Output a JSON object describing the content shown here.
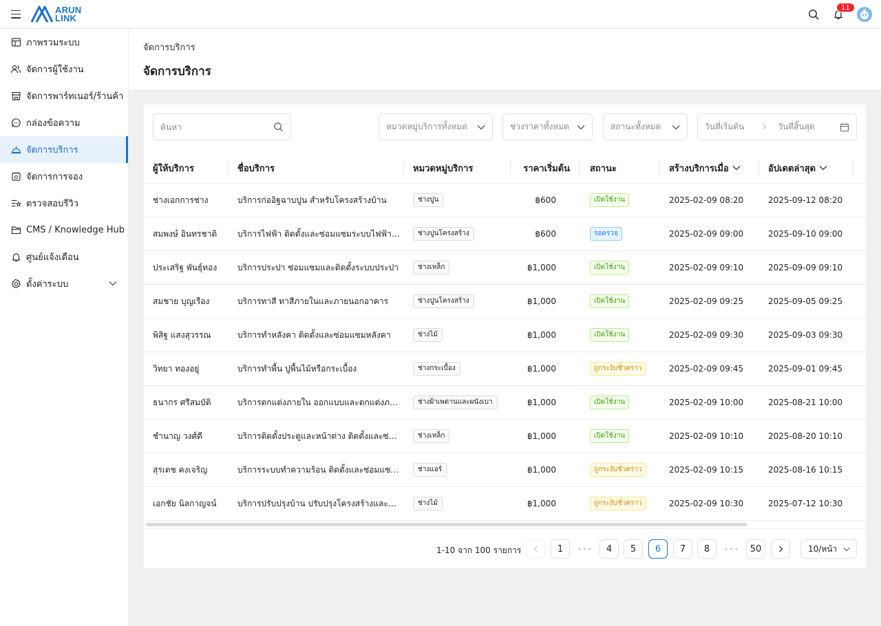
{
  "brand": {
    "line1": "ARUN",
    "line2": "LINK",
    "color": "#1a73c9"
  },
  "topbar": {
    "notification_count": "11"
  },
  "sidebar": {
    "items": [
      {
        "label": "ภาพรวมระบบ",
        "icon": "dashboard-icon"
      },
      {
        "label": "จัดการผู้ใช้งาน",
        "icon": "users-icon"
      },
      {
        "label": "จัดการพาร์ทเนอร์/ร้านค้า",
        "icon": "store-icon"
      },
      {
        "label": "กล่องข้อความ",
        "icon": "chat-icon"
      },
      {
        "label": "จัดการบริการ",
        "icon": "service-bell-icon",
        "active": true
      },
      {
        "label": "จัดการการจอง",
        "icon": "booking-calendar-icon"
      },
      {
        "label": "ตรวจสอบรีวิว",
        "icon": "review-icon"
      },
      {
        "label": "CMS / Knowledge Hub",
        "icon": "folder-icon"
      },
      {
        "label": "ศูนย์แจ้งเตือน",
        "icon": "bell-icon"
      },
      {
        "label": "ตั้งค่าระบบ",
        "icon": "settings-icon",
        "expandable": true
      }
    ]
  },
  "page": {
    "breadcrumb": "จัดการบริการ",
    "title": "จัดการบริการ"
  },
  "filters": {
    "search_placeholder": "ค้นหา",
    "category": "หมวดหมู่บริการทั้งหมด",
    "price": "ช่วงราคาทั้งหมด",
    "status": "สถานะทั้งหมด",
    "date_start": "วันที่เริ่มต้น",
    "date_end": "วันที่สิ้นสุด"
  },
  "table": {
    "columns": [
      "ผู้ให้บริการ",
      "ชื่อบริการ",
      "หมวดหมู่บริการ",
      "ราคาเริ่มต้น",
      "สถานะ",
      "สร้างบริการเมื่อ",
      "อัปเดตล่าสุด"
    ],
    "rows": [
      {
        "provider": "ช่างเอกการช่าง",
        "service": "บริการก่ออิฐฉาบปูน สำหรับโครงสร้างบ้าน",
        "category": "ช่างปูน",
        "price": "฿600",
        "status": "เปิดใช้งาน",
        "status_type": "active",
        "created": "2025-02-09 08:20",
        "updated": "2025-09-12 08:20"
      },
      {
        "provider": "สมพงษ์ อินทรชาติ",
        "service": "บริการไฟฟ้า ติดตั้งและซ่อมแซมระบบไฟฟ้าภายในบ้าน",
        "category": "ช่างปูนโครงสร้าง",
        "price": "฿600",
        "status": "รอตรวจ",
        "status_type": "pending",
        "created": "2025-02-09 09:00",
        "updated": "2025-09-10 09:00"
      },
      {
        "provider": "ประเสริฐ พันธุ์ทอง",
        "service": "บริการประปา ซ่อมแซมและติดตั้งระบบประปา",
        "category": "ช่างเหล็ก",
        "price": "฿1,000",
        "status": "เปิดใช้งาน",
        "status_type": "active",
        "created": "2025-02-09 09:10",
        "updated": "2025-09-09 09:10"
      },
      {
        "provider": "สมชาย บุญเรือง",
        "service": "บริการทาสี ทาสีภายในและภายนอกอาคาร",
        "category": "ช่างปูนโครงสร้าง",
        "price": "฿1,000",
        "status": "เปิดใช้งาน",
        "status_type": "active",
        "created": "2025-02-09 09:25",
        "updated": "2025-09-05 09:25"
      },
      {
        "provider": "พิสิฐ แสงสุวรรณ",
        "service": "บริการทำหลังคา ติดตั้งและซ่อมแซมหลังคา",
        "category": "ช่างไม้",
        "price": "฿1,000",
        "status": "เปิดใช้งาน",
        "status_type": "active",
        "created": "2025-02-09 09:30",
        "updated": "2025-09-03 09:30"
      },
      {
        "provider": "วิทยา ทองอยู่",
        "service": "บริการทำพื้น ปูพื้นไม้หรือกระเบื้อง",
        "category": "ช่างกระเบื้อง",
        "price": "฿1,000",
        "status": "ถูกระงับชั่วคราว",
        "status_type": "suspended",
        "created": "2025-02-09 09:45",
        "updated": "2025-09-01 09:45"
      },
      {
        "provider": "ธนากร ศรีสมบัติ",
        "service": "บริการตกแต่งภายใน ออกแบบและตกแต่งภายในบ้าน",
        "category": "ช่างฝ้าเพดานและผนังเบา",
        "price": "฿1,000",
        "status": "เปิดใช้งาน",
        "status_type": "active",
        "created": "2025-02-09 10:00",
        "updated": "2025-08-21 10:00"
      },
      {
        "provider": "ชำนาญ วงศ์ดี",
        "service": "บริการติดตั้งประตูและหน้าต่าง ติดตั้งและซ่อมแซม",
        "category": "ช่างเหล็ก",
        "price": "฿1,000",
        "status": "เปิดใช้งาน",
        "status_type": "active",
        "created": "2025-02-09 10:10",
        "updated": "2025-08-20 10:10"
      },
      {
        "provider": "สุรเดช คงเจริญ",
        "service": "บริการระบบทำความร้อน ติดตั้งและซ่อมแซมระบบ",
        "category": "ช่างแอร์",
        "price": "฿1,000",
        "status": "ถูกระงับชั่วคราว",
        "status_type": "suspended",
        "created": "2025-02-09 10:15",
        "updated": "2025-08-16 10:15"
      },
      {
        "provider": "เอกชัย นิลกาญจน์",
        "service": "บริการปรับปรุงบ้าน ปรับปรุงโครงสร้างและตกแต่ง",
        "category": "ช่างไม้",
        "price": "฿1,000",
        "status": "ถูกระงับชั่วคราว",
        "status_type": "suspended",
        "created": "2025-02-09 10:30",
        "updated": "2025-07-12 10:30"
      }
    ]
  },
  "pagination": {
    "summary": "1-10 จาก 100 รายการ",
    "pages": [
      "1",
      "4",
      "5",
      "6",
      "7",
      "8",
      "50"
    ],
    "current": "6",
    "page_size": "10/หน้า"
  }
}
